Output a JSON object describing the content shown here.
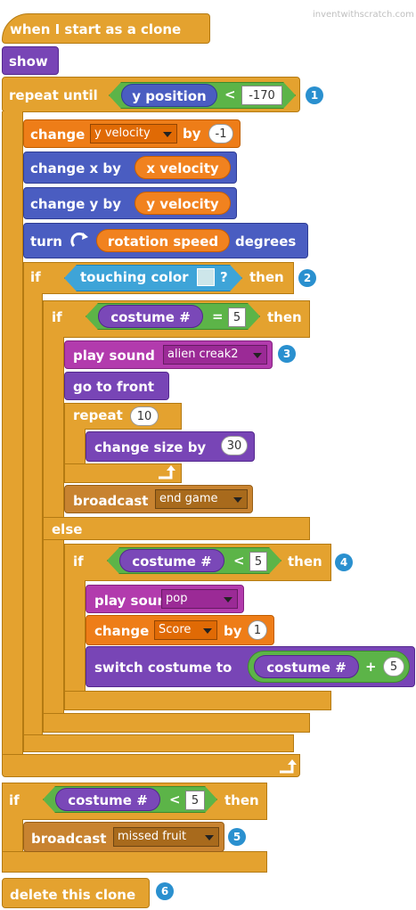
{
  "watermark": "inventwithscratch.com",
  "blocks": {
    "hat": "when I start as a clone",
    "show": "show",
    "repeat_until": {
      "label": "repeat until",
      "reporter": "y position",
      "op": "<",
      "value": "-170"
    },
    "change_yvel": {
      "label": "change",
      "var": "y velocity",
      "by": "by",
      "value": "-1"
    },
    "change_x": {
      "label": "change x  by",
      "reporter": "x velocity"
    },
    "change_y": {
      "label": "change y  by",
      "reporter": "y velocity"
    },
    "turn": {
      "label": "turn",
      "reporter": "rotation speed",
      "suffix": "degrees"
    },
    "if1": {
      "label": "if",
      "cond": "touching color",
      "q": "?",
      "then": "then"
    },
    "if2": {
      "label": "if",
      "reporter": "costume #",
      "op": "=",
      "value": "5",
      "then": "then"
    },
    "play1": {
      "label": "play sound",
      "sound": "alien creak2"
    },
    "front": "go to front",
    "repeat10": {
      "label": "repeat",
      "value": "10"
    },
    "change_size": {
      "label": "change size by",
      "value": "30"
    },
    "broadcast1": {
      "label": "broadcast",
      "msg": "end game"
    },
    "else": "else",
    "if3": {
      "label": "if",
      "reporter": "costume #",
      "op": "<",
      "value": "5",
      "then": "then"
    },
    "play2": {
      "label": "play sound",
      "sound": "pop"
    },
    "change_score": {
      "label": "change",
      "var": "Score",
      "by": "by",
      "value": "1"
    },
    "switch": {
      "label": "switch costume to",
      "reporter": "costume #",
      "op": "+",
      "value": "5"
    },
    "if4": {
      "label": "if",
      "reporter": "costume #",
      "op": "<",
      "value": "5",
      "then": "then"
    },
    "broadcast2": {
      "label": "broadcast",
      "msg": "missed fruit"
    },
    "delete": "delete this clone"
  },
  "badges": [
    "1",
    "2",
    "3",
    "4",
    "5",
    "6"
  ],
  "colors": {
    "control": "#e4a22f",
    "looks": "#7845b6",
    "motion": "#4a5dc1",
    "data": "#ee7d18",
    "sound": "#b23bad",
    "events": "#c88330",
    "operators": "#5cb448",
    "sensing": "#3ea4d8",
    "badge": "#2a90cf",
    "touch_color": "#cde6ea"
  }
}
